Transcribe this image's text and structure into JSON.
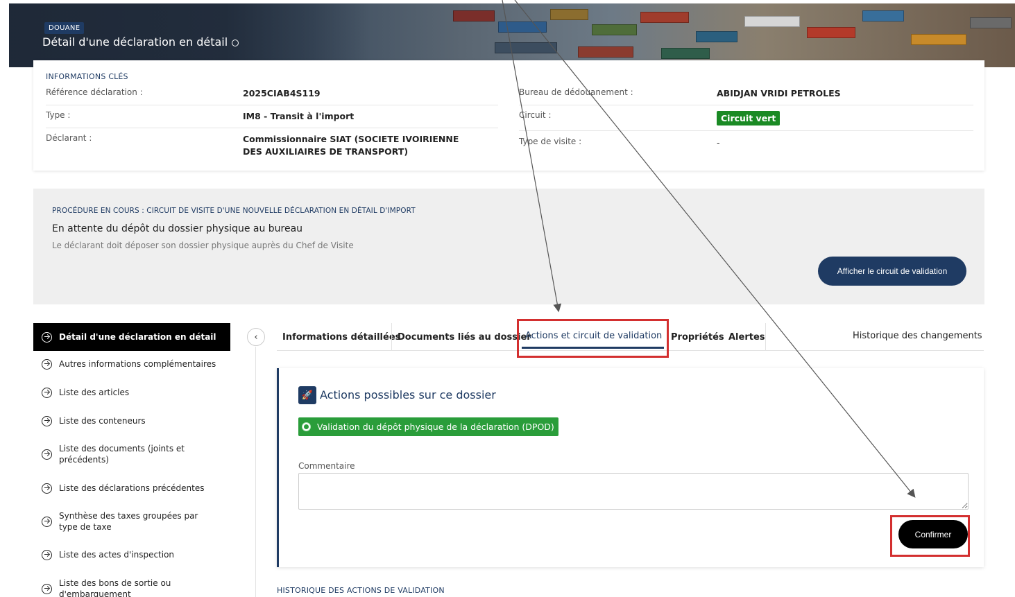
{
  "header": {
    "badge": "DOUANE",
    "title": "Détail d'une déclaration en détail"
  },
  "key_info": {
    "caption": "INFORMATIONS CLÉS",
    "left": [
      {
        "label": "Référence déclaration :",
        "value": "2025CIAB4S119"
      },
      {
        "label": "Type :",
        "value": "IM8 - Transit à l'import"
      },
      {
        "label": "Déclarant :",
        "value": "Commissionnaire SIAT (SOCIETE IVOIRIENNE DES AUXILIAIRES DE TRANSPORT)"
      }
    ],
    "right": [
      {
        "label": "Bureau de dédouanement :",
        "value": "ABIDJAN VRIDI PETROLES"
      },
      {
        "label": "Circuit :",
        "value": "Circuit vert"
      },
      {
        "label": "Type de visite :",
        "value": "-"
      }
    ],
    "circuit_color": "#1a8a24"
  },
  "procedure": {
    "caption": "PROCÉDURE EN COURS : CIRCUIT DE VISITE D'UNE NOUVELLE DÉCLARATION EN DÉTAIL D'IMPORT",
    "title": "En attente du dépôt du dossier physique au bureau",
    "subtitle": "Le déclarant doit déposer son dossier physique auprès du Chef de Visite",
    "button": "Afficher le circuit de validation"
  },
  "sidebar": {
    "items": [
      {
        "label": "Détail d'une déclaration en détail",
        "active": true
      },
      {
        "label": "Autres informations complémentaires"
      },
      {
        "label": "Liste des articles"
      },
      {
        "label": "Liste des conteneurs"
      },
      {
        "label": "Liste des documents (joints et précédents)"
      },
      {
        "label": "Liste des déclarations précédentes"
      },
      {
        "label": "Synthèse des taxes groupées par type de taxe"
      },
      {
        "label": "Liste des actes d'inspection"
      },
      {
        "label": "Liste des bons de sortie ou d'embarquement"
      }
    ]
  },
  "tabs": [
    {
      "label": "Informations détaillées"
    },
    {
      "label": "Documents liés au dossier"
    },
    {
      "label": "Actions et circuit de validation",
      "active": true
    },
    {
      "label": "Propriétés"
    },
    {
      "label": "Alertes"
    },
    {
      "label": "Historique des changements"
    }
  ],
  "actions": {
    "title": "Actions possibles sur ce dossier",
    "option": "Validation du dépôt physique de la déclaration (DPOD)",
    "comment_label": "Commentaire",
    "comment_value": "",
    "confirm": "Confirmer"
  },
  "history": {
    "caption": "HISTORIQUE DES ACTIONS DE VALIDATION"
  },
  "colors": {
    "primary": "#1f3b63",
    "success": "#2a9d3a",
    "highlight": "#d32f2f"
  }
}
